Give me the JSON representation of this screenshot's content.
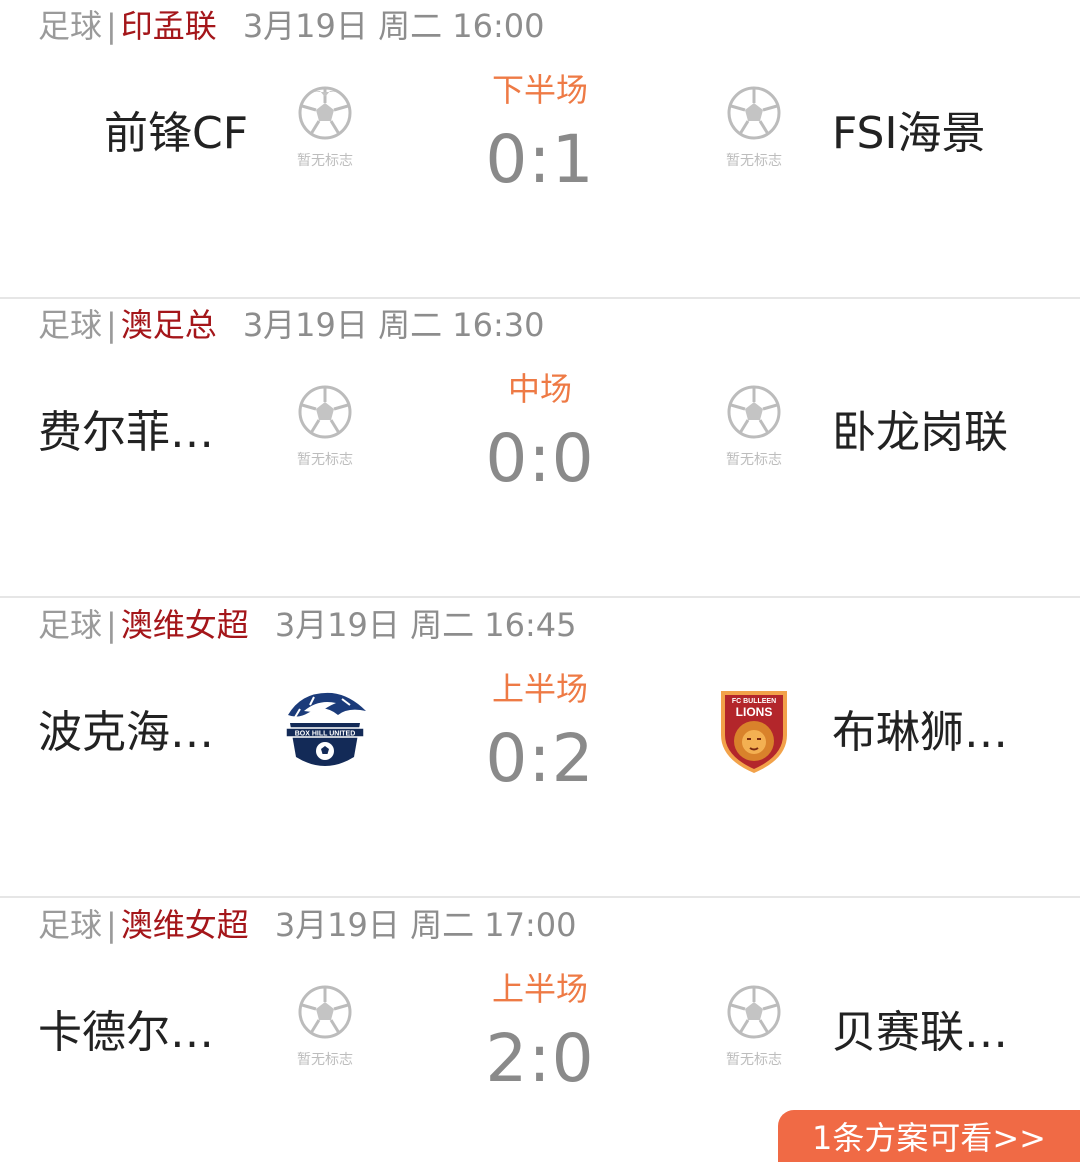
{
  "matches": [
    {
      "sport": "足球",
      "separator": "|",
      "league": "印孟联",
      "datetime": "3月19日 周二 16:00",
      "status": "下半场",
      "score": "0:1",
      "home": {
        "name": "前锋CF",
        "logo": "no-logo-placeholder",
        "logo_caption": "暂无标志"
      },
      "away": {
        "name": "FSI海景",
        "logo": "no-logo-placeholder",
        "logo_caption": "暂无标志"
      }
    },
    {
      "sport": "足球",
      "separator": "|",
      "league": "澳足总",
      "datetime": "3月19日 周二 16:30",
      "status": "中场",
      "score": "0:0",
      "home": {
        "name": "费尔菲尔...",
        "logo": "no-logo-placeholder",
        "logo_caption": "暂无标志"
      },
      "away": {
        "name": "卧龙岗联",
        "logo": "no-logo-placeholder",
        "logo_caption": "暂无标志"
      }
    },
    {
      "sport": "足球",
      "separator": "|",
      "league": "澳维女超",
      "datetime": "3月19日 周二 16:45",
      "status": "上半场",
      "score": "0:2",
      "home": {
        "name": "波克海尔...",
        "logo": "box-hill-united-crest",
        "logo_text": "BOX HILL UNITED"
      },
      "away": {
        "name": "布琳狮子...",
        "logo": "fc-bulleen-lions-crest",
        "logo_text": "FC BULLEEN",
        "logo_text_2": "LIONS"
      }
    },
    {
      "sport": "足球",
      "separator": "|",
      "league": "澳维女超",
      "datetime": "3月19日 周二 17:00",
      "status": "上半场",
      "score": "2:0",
      "home": {
        "name": "卡德尔联...",
        "logo": "no-logo-placeholder",
        "logo_caption": "暂无标志"
      },
      "away": {
        "name": "贝赛联女...",
        "logo": "no-logo-placeholder",
        "logo_caption": "暂无标志"
      }
    }
  ],
  "plan_button": {
    "label": "1条方案可看>>"
  },
  "colors": {
    "league": "#a4161a",
    "status": "#ee7a45",
    "score": "#8a8a8a",
    "button": "#f06a45"
  }
}
